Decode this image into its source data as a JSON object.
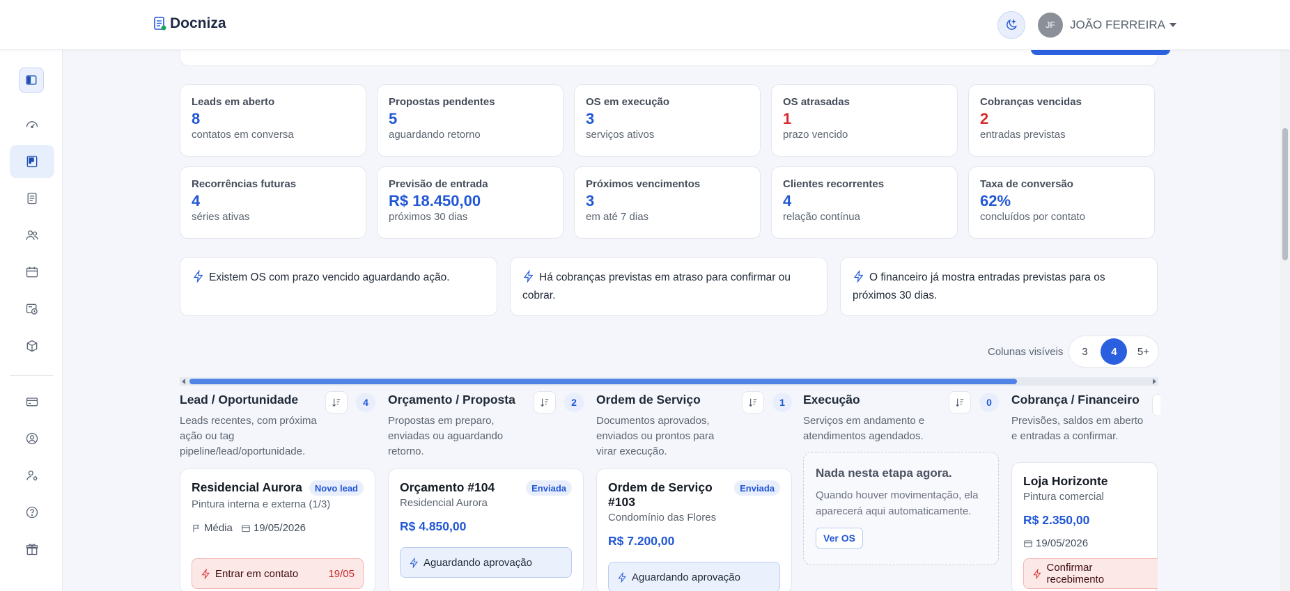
{
  "header": {
    "brand": "Docniza",
    "user_initials": "JF",
    "user_name": "JOÃO FERREIRA"
  },
  "sidebar": {
    "items": [
      {
        "name": "toggle-sidebar",
        "icon": "panel-icon"
      },
      {
        "name": "dashboard",
        "icon": "gauge-icon"
      },
      {
        "name": "kanban",
        "icon": "kanban-icon",
        "active": true
      },
      {
        "name": "documents",
        "icon": "document-icon"
      },
      {
        "name": "clients",
        "icon": "users-icon"
      },
      {
        "name": "calendar",
        "icon": "calendar-icon"
      },
      {
        "name": "billing-schedule",
        "icon": "money-clock-icon"
      },
      {
        "name": "products",
        "icon": "box-icon"
      },
      {
        "name": "payments",
        "icon": "credit-card-icon"
      },
      {
        "name": "profile",
        "icon": "user-circle-icon"
      },
      {
        "name": "user-settings",
        "icon": "user-gear-icon"
      },
      {
        "name": "help",
        "icon": "help-icon"
      },
      {
        "name": "gifts",
        "icon": "gift-icon"
      }
    ]
  },
  "stats": [
    {
      "label": "Leads em aberto",
      "value": "8",
      "sub": "contatos em conversa",
      "color": "#2157d6"
    },
    {
      "label": "Propostas pendentes",
      "value": "5",
      "sub": "aguardando retorno",
      "color": "#2157d6"
    },
    {
      "label": "OS em execução",
      "value": "3",
      "sub": "serviços ativos",
      "color": "#2157d6"
    },
    {
      "label": "OS atrasadas",
      "value": "1",
      "sub": "prazo vencido",
      "color": "#d92b2b"
    },
    {
      "label": "Cobranças vencidas",
      "value": "2",
      "sub": "entradas previstas",
      "color": "#d92b2b"
    },
    {
      "label": "Recorrências futuras",
      "value": "4",
      "sub": "séries ativas",
      "color": "#2157d6"
    },
    {
      "label": "Previsão de entrada",
      "value": "R$ 18.450,00",
      "sub": "próximos 30 dias",
      "color": "#2157d6"
    },
    {
      "label": "Próximos vencimentos",
      "value": "3",
      "sub": "em até 7 dias",
      "color": "#2157d6"
    },
    {
      "label": "Clientes recorrentes",
      "value": "4",
      "sub": "relação contínua",
      "color": "#2157d6"
    },
    {
      "label": "Taxa de conversão",
      "value": "62%",
      "sub": "concluídos por contato",
      "color": "#2157d6"
    }
  ],
  "alerts": [
    "Existem OS com prazo vencido aguardando ação.",
    "Há cobranças previstas em atraso para confirmar ou cobrar.",
    "O financeiro já mostra entradas previstas para os próximos 30 dias."
  ],
  "columns_visible": {
    "label": "Colunas visíveis",
    "options": [
      "3",
      "4",
      "5+"
    ],
    "selected": "4"
  },
  "kanban": {
    "columns": [
      {
        "title": "Lead / Oportunidade",
        "count": "4",
        "desc": "Leads recentes, com próxima ação ou tag pipeline/lead/oportunidade."
      },
      {
        "title": "Orçamento / Proposta",
        "count": "2",
        "desc": "Propostas em preparo, enviadas ou aguardando retorno."
      },
      {
        "title": "Ordem de Serviço",
        "count": "1",
        "desc": "Documentos aprovados, enviados ou prontos para virar execução."
      },
      {
        "title": "Execução",
        "count": "0",
        "desc": "Serviços em andamento e atendimentos agendados."
      },
      {
        "title": "Cobrança / Financeiro",
        "count": "",
        "desc": "Previsões, saldos em aberto e entradas a confirmar."
      }
    ],
    "cards": {
      "lead": {
        "title": "Residencial Aurora",
        "badge": "Novo lead",
        "subtitle": "Pintura interna e externa (1/3)",
        "priority": "Média",
        "date": "19/05/2026",
        "action": "Entrar em contato",
        "action_date": "19/05"
      },
      "proposal": {
        "title": "Orçamento #104",
        "badge": "Enviada",
        "subtitle": "Residencial Aurora",
        "amount": "R$ 4.850,00",
        "status": "Aguardando aprovação"
      },
      "service_order": {
        "title": "Ordem de Serviço #103",
        "badge": "Enviada",
        "subtitle": "Condomínio das Flores",
        "amount": "R$ 7.200,00",
        "status": "Aguardando aprovação"
      },
      "execution_empty": {
        "title": "Nada nesta etapa agora.",
        "desc": "Quando houver movimentação, ela aparecerá aqui automaticamente.",
        "button": "Ver OS"
      },
      "billing": {
        "title": "Loja Horizonte",
        "subtitle": "Pintura comercial",
        "amount": "R$ 2.350,00",
        "date": "19/05/2026",
        "action": "Confirmar recebimento"
      }
    }
  }
}
